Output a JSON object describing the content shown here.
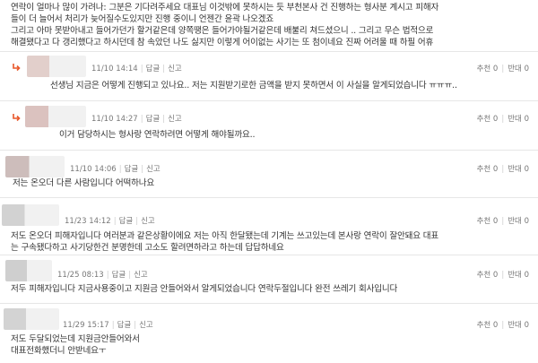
{
  "top_post": {
    "text": "연락이 얼마나 많이 가려나: 그분은 기다려주세요 대표님 이것밖에 못하시는 듯 부천본사 건 진행하는 형사분 계시고 피해자\n들이 더 늘어서 처리가 늦어질수도있지만 진행 중이니 언젠간 윤곽 나오겠죠\n그리고 아마 못받아내고 들어가던가 할거같은데 양쪽땡은 들어가야될거같은데 배불리 쳐드셨으니 .. 그리고 무슨 법적으로\n해결됐다고 다 갱리했다고 하시던데 참 속았던 나도 싫지만 이렇게 어이없는 사기는 또 첨이네요 진짜 어려울 때 하필 어휴"
  },
  "comments": [
    {
      "date": "11/10 14:14",
      "reply_label": "답글",
      "report_label": "신고",
      "text": "선생님 지금은 어떻게 진행되고 있나요.. 저는 지원받기로한 금액을 받지 못하면서 이 사실을 알게되었습니다 ㅠㅠㅠ..",
      "upvote_label": "추천 0",
      "downvote_label": "반대 0",
      "is_reply": true,
      "avatar_color": "#e2cfcb"
    },
    {
      "date": "11/10 14:27",
      "reply_label": "답글",
      "report_label": "신고",
      "text": "이거 담당하시는 형사랑 연락하려면 어떻게 해야될까요..",
      "upvote_label": "추천 0",
      "downvote_label": "반대 0",
      "is_reply": true,
      "avatar_color": "#dbc2bf"
    },
    {
      "date": "11/10 14:06",
      "reply_label": "답글",
      "report_label": "신고",
      "text": "저는 온오더 다른 사람입니다 어떡하나요",
      "upvote_label": "추천 0",
      "downvote_label": "반대 0",
      "is_reply": false,
      "avatar_color": "#cdbdbb"
    },
    {
      "date": "11/23 14:12",
      "reply_label": "답글",
      "report_label": "신고",
      "text": "저도 온오더 피해자입니다 여러분과 같은상황이에요 저는 아직 한달됐는데 기계는 쓰고있는데 본사랑 연락이 잘안돼요 대표\n는 구속됐다하고 사기당한건 분명한데 고소도 할려면하라고 하는데 답답하네요",
      "upvote_label": "추천 0",
      "downvote_label": "반대 0",
      "is_reply": false,
      "avatar_color": "#d2d2d2"
    },
    {
      "date": "11/25 08:13",
      "reply_label": "답글",
      "report_label": "신고",
      "text": "저두 피해자입니다 지금사용중이고 지원금 안들어와서 알게되었습니다 연락두절입니다 완전 쓰레기 회사입니다",
      "upvote_label": "추천 0",
      "downvote_label": "반대 0",
      "is_reply": false,
      "avatar_color": "#cfcfcf"
    },
    {
      "date": "11/29 15:17",
      "reply_label": "답글",
      "report_label": "신고",
      "text": "저도 두달되었는데 지원금안들어와서\n대표전화했더니 안받네요ㅜ",
      "upvote_label": "추천 0",
      "downvote_label": "반대 0",
      "is_reply": false,
      "avatar_color": "#d3d3d3"
    }
  ],
  "colors": {
    "reply_arrow": "#e8572a",
    "divider": "#e6e6e6",
    "meta_text": "#777777"
  }
}
